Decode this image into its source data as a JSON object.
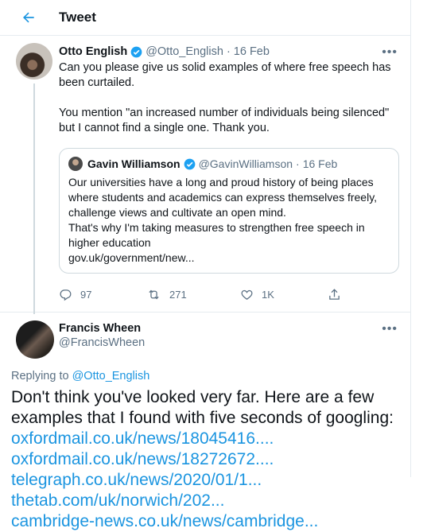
{
  "header": {
    "title": "Tweet"
  },
  "tweet": {
    "name": "Otto English",
    "handle": "@Otto_English",
    "date": "16 Feb",
    "text": "Can you please give us solid examples of where free speech has been curtailed.\n\nYou mention \"an increased number of individuals being silenced\" but I cannot find a single one. Thank you.",
    "quote": {
      "name": "Gavin Williamson",
      "handle": "@GavinWilliamson",
      "date": "16 Feb",
      "text": "Our universities have a long and proud history of being places where students and academics can express themselves freely, challenge views and cultivate an open mind.\nThat's why I'm taking measures to strengthen free speech in higher education",
      "link": "gov.uk/government/new..."
    },
    "actions": {
      "replies": "97",
      "retweets": "271",
      "likes": "1K"
    }
  },
  "reply": {
    "name": "Francis Wheen",
    "handle": "@FrancisWheen",
    "replying_prefix": "Replying to",
    "replying_to": "@Otto_English",
    "text": "Don't think you've looked very far. Here are a few examples that I found with five seconds of googling:",
    "links": [
      "oxfordmail.co.uk/news/18045416....",
      "oxfordmail.co.uk/news/18272672....",
      "telegraph.co.uk/news/2020/01/1...",
      "thetab.com/uk/norwich/202...",
      "cambridge-news.co.uk/news/cambridge..."
    ]
  },
  "colors": {
    "accent": "#1b95e0",
    "secondary": "#5b7083",
    "border": "#e6ecf0"
  }
}
